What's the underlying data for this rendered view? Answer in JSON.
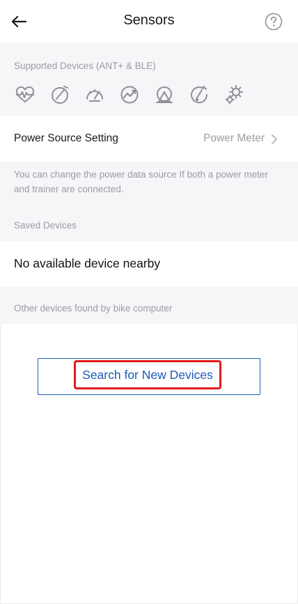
{
  "header": {
    "title": "Sensors",
    "back_icon": "arrow-left-icon",
    "help_icon": "question-circle-icon"
  },
  "supported": {
    "label": "Supported Devices (ANT+ & BLE)",
    "icons": [
      "heart-rate-icon",
      "speed-sensor-icon",
      "speedometer-icon",
      "power-icon",
      "trainer-icon",
      "cadence-icon",
      "gear-shift-icon"
    ]
  },
  "power_source": {
    "label": "Power Source Setting",
    "value": "Power Meter",
    "description": "You can change the power data source If both a power meter and trainer are connected."
  },
  "saved_devices": {
    "label": "Saved Devices",
    "empty_text": "No available device nearby"
  },
  "other_devices": {
    "label": "Other devices found by bike computer"
  },
  "search": {
    "button_label": "Search for New Devices"
  },
  "colors": {
    "accent": "#1a5bb8",
    "highlight": "#e21b1b",
    "muted": "#9a9ca2",
    "section_bg": "#f5f6f8"
  }
}
